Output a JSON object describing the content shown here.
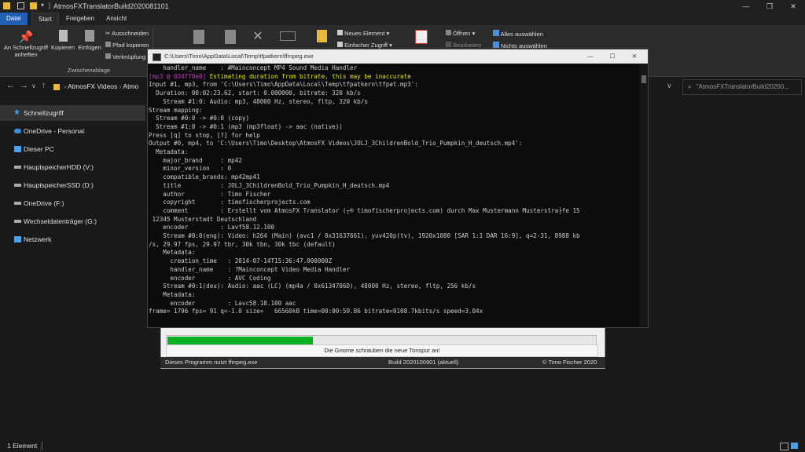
{
  "window": {
    "title": "AtmosFXTranslatorBuild2020081101",
    "controls": [
      "—",
      "❐",
      "✕"
    ]
  },
  "ribbon_tabs": [
    "Datei",
    "Start",
    "Freigeben",
    "Ansicht"
  ],
  "ribbon": {
    "pin_label": "An Schnellzugriff anheften",
    "copy_label": "Kopieren",
    "paste_label": "Einfügen",
    "cut_label": "Ausschneiden",
    "copy_path_label": "Pfad kopieren",
    "paste_shortcut_label": "Verknüpfung",
    "clipboard_group": "Zwischenablage",
    "new_element_label": "Neues Element",
    "easy_access_label": "Einfacher Zugriff",
    "open_label": "Öffnen",
    "edit_label": "Bearbeiten",
    "select_all_label": "Alles auswählen",
    "select_none_label": "Nichts auswählen"
  },
  "address": {
    "path_segments": [
      "AtmosFX Videos",
      "Atmo"
    ],
    "search_placeholder": "\"AtmosFXTranslatorBuild20200..."
  },
  "sidebar": {
    "items": [
      {
        "label": "Schnellzugriff",
        "icon": "star-icon",
        "selected": true
      },
      {
        "label": "OneDrive - Personal",
        "icon": "cloud-icon",
        "selected": false
      },
      {
        "label": "Dieser PC",
        "icon": "computer-icon",
        "selected": false
      },
      {
        "label": "HauptspeicherHDD (V:)",
        "icon": "drive-icon",
        "selected": false
      },
      {
        "label": "HauptspeicherSSD (D:)",
        "icon": "drive-icon",
        "selected": false
      },
      {
        "label": "OneDrive (F:)",
        "icon": "drive-icon",
        "selected": false
      },
      {
        "label": "Wechseldatenträger (G:)",
        "icon": "drive-icon",
        "selected": false
      },
      {
        "label": "Netzwerk",
        "icon": "network-icon",
        "selected": false
      }
    ]
  },
  "status_bar": {
    "count": "1 Element"
  },
  "app": {
    "progress": 0.34,
    "message": "Die Gnome schrauben die neue Tonspur an!",
    "footer_left": "Dieses Programm nutzt ffmpeg.exe",
    "footer_mid": "Build 2020100901 (aktuell)",
    "footer_right": "© Timo Fischer 2020"
  },
  "console": {
    "title": "C:\\Users\\Timo\\AppData\\Local\\Temp\\tfpatkern\\ffmpeg.exe",
    "lines": [
      {
        "text": "    handler_name    : #Mainconcept MP4 Sound Media Handler",
        "style": "normal"
      },
      {
        "prefix": "[mp3 @ 034f78e0] ",
        "text": "Estimating duration from bitrate, this may be inaccurate",
        "style": "warn"
      },
      {
        "text": "Input #1, mp3, from 'C:\\Users\\Timo\\AppData\\Local\\Temp\\tfpatkern\\tfpat.mp3':",
        "style": "normal"
      },
      {
        "text": "  Duration: 00:02:23.62, start: 0.000000, bitrate: 320 kb/s",
        "style": "normal"
      },
      {
        "text": "    Stream #1:0: Audio: mp3, 48000 Hz, stereo, fltp, 320 kb/s",
        "style": "normal"
      },
      {
        "text": "Stream mapping:",
        "style": "normal"
      },
      {
        "text": "  Stream #0:0 -> #0:0 (copy)",
        "style": "normal"
      },
      {
        "text": "  Stream #1:0 -> #0:1 (mp3 (mp3float) -> aac (native))",
        "style": "normal"
      },
      {
        "text": "Press [q] to stop, [?] for help",
        "style": "normal"
      },
      {
        "text": "Output #0, mp4, to 'C:\\Users\\Timo\\Desktop\\AtmosFX Videos\\JOLJ_3ChildrenBold_Trio_Pumpkin_H_deutsch.mp4':",
        "style": "normal"
      },
      {
        "text": "  Metadata:",
        "style": "normal"
      },
      {
        "text": "    major_brand     : mp42",
        "style": "normal"
      },
      {
        "text": "    minor_version   : 0",
        "style": "normal"
      },
      {
        "text": "    compatible_brands: mp42mp41",
        "style": "normal"
      },
      {
        "text": "    title           : JOLJ_3ChildrenBold_Trio_Pumpkin_H_deutsch.mp4",
        "style": "normal"
      },
      {
        "text": "    author          : Timo Fischer",
        "style": "normal"
      },
      {
        "text": "    copyright       : timofischerprojects.com",
        "style": "normal"
      },
      {
        "text": "    comment         : Erstellt vom AtmosFX Translator (┬® timofischerprojects.com) durch Max Mustermann Musterstra├fe 15",
        "style": "normal"
      },
      {
        "text": " 12345 Musterstadt Deutschland",
        "style": "normal"
      },
      {
        "text": "    encoder         : Lavf58.12.100",
        "style": "normal"
      },
      {
        "text": "    Stream #0:0(eng): Video: h264 (Main) (avc1 / 0x31637661), yuv420p(tv), 1920x1080 [SAR 1:1 DAR 16:9], q=2-31, 8988 kb",
        "style": "normal"
      },
      {
        "text": "/s, 29.97 fps, 29.97 tbr, 30k tbn, 30k tbc (default)",
        "style": "normal"
      },
      {
        "text": "    Metadata:",
        "style": "normal"
      },
      {
        "text": "      creation_time   : 2014-07-14T15:36:47.000000Z",
        "style": "normal"
      },
      {
        "text": "      handler_name    : ?Mainconcept Video Media Handler",
        "style": "normal"
      },
      {
        "text": "      encoder         : AVC Coding",
        "style": "normal"
      },
      {
        "text": "    Stream #0:1(deu): Audio: aac (LC) (mp4a / 0x6134706D), 48000 Hz, stereo, fltp, 256 kb/s",
        "style": "normal"
      },
      {
        "text": "    Metadata:",
        "style": "normal"
      },
      {
        "text": "      encoder         : Lavc58.18.100 aac",
        "style": "normal"
      },
      {
        "text": "frame= 1796 fps= 91 q=-1.0 size=   66560kB time=00:00:59.86 bitrate=9108.7kbits/s speed=3.04x",
        "style": "normal"
      }
    ]
  },
  "colors": {
    "accent": "#1f5fb4",
    "progress": "#06b025",
    "console_bg": "#0c0c0c",
    "warn": "#e5e510",
    "warn_prefix": "#c23bc2"
  }
}
